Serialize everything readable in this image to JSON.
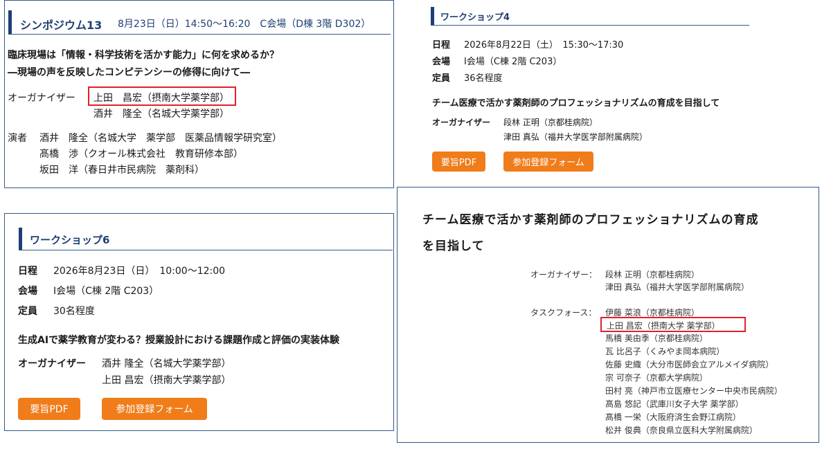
{
  "symposium": {
    "title": "シンポジウム13",
    "schedule": "8月23日（日）14:50～16:20　C会場（D棟 3階 D302）",
    "theme_line1": "臨床現場は「情報・科学技術を活かす能力」に何を求めるか？",
    "theme_line2": "―現場の声を反映したコンピテンシーの修得に向けて―",
    "organizer_label": "オーガナイザー",
    "organizers": [
      "上田　昌宏（摂南大学薬学部）",
      "酒井　隆全（名城大学薬学部）"
    ],
    "speaker_label": "演者",
    "speakers": [
      "酒井　隆全（名城大学　薬学部　医薬品情報学研究室）",
      "髙橋　渉（クオール株式会社　教育研修本部）",
      "坂田　洋（春日井市民病院　薬剤科）"
    ]
  },
  "workshop4": {
    "title": "ワークショップ4",
    "date_label": "日程",
    "date_value": "2026年8月22日（土）　15:30～17:30",
    "venue_label": "会場",
    "venue_value": "I会場（C棟 2階 C203）",
    "capacity_label": "定員",
    "capacity_value": "36名程度",
    "theme": "チーム医療で活かす薬剤師のプロフェッショナリズムの育成を目指して",
    "organizer_label": "オーガナイザー",
    "organizers": [
      "段林 正明（京都桂病院）",
      "津田 真弘（福井大学医学部附属病院）"
    ],
    "pdf_button": "要旨PDF",
    "register_button": "参加登録フォーム"
  },
  "workshop6": {
    "title": "ワークショップ6",
    "date_label": "日程",
    "date_value": "2026年8月23日（日）　10:00～12:00",
    "venue_label": "会場",
    "venue_value": "I会場（C棟 2階 C203）",
    "capacity_label": "定員",
    "capacity_value": "30名程度",
    "theme": "生成AIで薬学教育が変わる？授業設計における課題作成と評価の実装体験",
    "organizer_label": "オーガナイザー",
    "organizers": [
      "酒井 隆全（名城大学薬学部）",
      "上田 昌宏（摂南大学薬学部）"
    ],
    "pdf_button": "要旨PDF",
    "register_button": "参加登録フォーム"
  },
  "document": {
    "title_line1": "チーム医療で活かす薬剤師のプロフェッショナリズムの育成",
    "title_line2": "を目指して",
    "organizer_label": "オーガナイザー：",
    "organizers": [
      "段林 正明（京都桂病院）",
      "津田 真弘（福井大学医学部附属病院）"
    ],
    "taskforce_label": "タスクフォース：",
    "taskforce": [
      "伊藤 菜浪（京都桂病院）",
      "上田 昌宏（摂南大学 薬学部）",
      "馬橋 美由季（京都桂病院）",
      "瓦 比呂子（くみやま岡本病院）",
      "佐藤 史織（大分市医師会立アルメイダ病院）",
      "宗 可奈子（京都大学病院）",
      "田村 亮（神戸市立医療センター中央市民病院）",
      "髙島 悠記（武庫川女子大学 薬学部）",
      "髙橋 一栄（大阪府済生会野江病院）",
      "松井 俊典（奈良県立医科大学附属病院）"
    ]
  },
  "colors": {
    "accent": "#1f3f73",
    "border": "#2f5a86",
    "button": "#f07c1a",
    "highlight": "#e0202a"
  }
}
